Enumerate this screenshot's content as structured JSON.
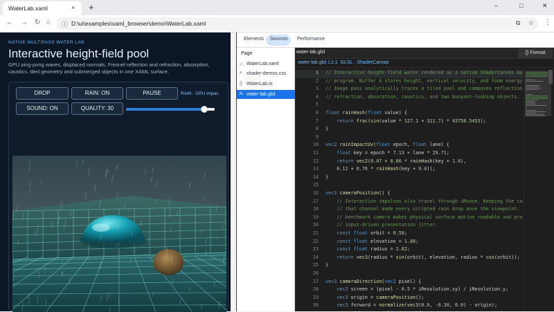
{
  "browser": {
    "tab_title": "WaterLab.xaml",
    "tab_close": "×",
    "new_tab": "+",
    "window_controls": {
      "minimize": "–",
      "maximize": "□",
      "close": "✕"
    },
    "nav": {
      "back": "←",
      "forward": "→",
      "reload": "↻",
      "home": "⌂"
    },
    "url": "D:\\ui\\examples\\xaml_browser\\demo\\WaterLab.xaml",
    "menu": "⋮"
  },
  "page": {
    "eyebrow": "NATIVE MULTIPASS WATER LAB",
    "title": "Interactive height-field pool",
    "description": "GPU ping-pong waves, displaced normals, Fresnel reflection and refraction, absorption, caustics, tiled geometry and submerged objects in one XAML surface.",
    "controls": {
      "drop": "DROP",
      "rain": "RAIN: ON",
      "pause": "PAUSE",
      "sound": "SOUND: ON",
      "quality": "QUALITY: 30",
      "status": "RAIN · GPU impac",
      "quality_slider_fraction": 0.88
    }
  },
  "devtools": {
    "tabs": [
      "Elements",
      "Sources",
      "Performance"
    ],
    "active_tab": "Sources",
    "files_header": "Page",
    "files": [
      {
        "icon": "◇",
        "name": "WaterLab.xaml"
      },
      {
        "icon": "#",
        "name": "shader-demos.css"
      },
      {
        "icon": "{}",
        "name": "WaterLab.ts"
      },
      {
        "icon": "fx",
        "name": "water-lab.glsl"
      }
    ],
    "editor": {
      "open_file": "water-lab.glsl",
      "format_label": "{}  Format",
      "status_file": "water-lab.glsl",
      "status_meta": "L1:1  GLSL · ShaderCanvas",
      "lines": [
        [
          [
            "c",
            "// Interactive height-field water rendered as a native ShaderCanvas mu"
          ]
        ],
        [
          [
            "c",
            "// program. Buffer A stores height, vertical velocity, and foam energy"
          ]
        ],
        [
          [
            "c",
            "// Image pass analytically traces a tiled pool and composes reflection"
          ]
        ],
        [
          [
            "c",
            "// refraction, absorption, caustics, and two buoyant-looking objects."
          ]
        ],
        [],
        [
          [
            "k",
            "float "
          ],
          [
            "f",
            "rainHash"
          ],
          [
            "i",
            "("
          ],
          [
            "k",
            "float "
          ],
          [
            "i",
            "value) {"
          ]
        ],
        [
          [
            "i",
            "    "
          ],
          [
            "k",
            "return "
          ],
          [
            "f",
            "frac"
          ],
          [
            "i",
            "("
          ],
          [
            "f",
            "sin"
          ],
          [
            "i",
            "(value * "
          ],
          [
            "n",
            "127.1"
          ],
          [
            "i",
            " + "
          ],
          [
            "n",
            "311.7"
          ],
          [
            "i",
            ") * "
          ],
          [
            "n",
            "43758.5453"
          ],
          [
            "i",
            ");"
          ]
        ],
        [
          [
            "i",
            "}"
          ]
        ],
        [],
        [
          [
            "k",
            "vec2 "
          ],
          [
            "f",
            "rainImpactUv"
          ],
          [
            "i",
            "("
          ],
          [
            "k",
            "float "
          ],
          [
            "i",
            "epoch, "
          ],
          [
            "k",
            "float "
          ],
          [
            "i",
            "lane) {"
          ]
        ],
        [
          [
            "i",
            "    "
          ],
          [
            "k",
            "float "
          ],
          [
            "i",
            "key = epoch * "
          ],
          [
            "n",
            "7.13"
          ],
          [
            "i",
            " + lane * "
          ],
          [
            "n",
            "29.71"
          ],
          [
            "i",
            ";"
          ]
        ],
        [
          [
            "i",
            "    "
          ],
          [
            "k",
            "return "
          ],
          [
            "f",
            "vec2"
          ],
          [
            "i",
            "("
          ],
          [
            "n",
            "0.07"
          ],
          [
            "i",
            " + "
          ],
          [
            "n",
            "0.86"
          ],
          [
            "i",
            " * "
          ],
          [
            "f",
            "rainHash"
          ],
          [
            "i",
            "(key + "
          ],
          [
            "n",
            "1.0"
          ],
          [
            "i",
            "),"
          ]
        ],
        [
          [
            "i",
            "    "
          ],
          [
            "n",
            "0.12"
          ],
          [
            "i",
            " + "
          ],
          [
            "n",
            "0.76"
          ],
          [
            "i",
            " * "
          ],
          [
            "f",
            "rainHash"
          ],
          [
            "i",
            "(key + "
          ],
          [
            "n",
            "9.0"
          ],
          [
            "i",
            "));"
          ]
        ],
        [
          [
            "i",
            "}"
          ]
        ],
        [],
        [
          [
            "k",
            "vec3 "
          ],
          [
            "f",
            "cameraPosition"
          ],
          [
            "i",
            "() {"
          ]
        ],
        [
          [
            "i",
            "    "
          ],
          [
            "c",
            "// Interaction impulses also travel through iMouse. Keeping the ca"
          ]
        ],
        [
          [
            "i",
            "    "
          ],
          [
            "c",
            "// that channel made every scripted rain drop move the viewpoint. ."
          ]
        ],
        [
          [
            "i",
            "    "
          ],
          [
            "c",
            "// benchmark camera makes physical surface motion readable and pre"
          ]
        ],
        [
          [
            "i",
            "    "
          ],
          [
            "c",
            "// input-driven presentation jitter."
          ]
        ],
        [
          [
            "i",
            "    "
          ],
          [
            "k",
            "const float "
          ],
          [
            "i",
            "orbit = "
          ],
          [
            "n",
            "0.58"
          ],
          [
            "i",
            ";"
          ]
        ],
        [
          [
            "i",
            "    "
          ],
          [
            "k",
            "const float "
          ],
          [
            "i",
            "elevation = "
          ],
          [
            "n",
            "1.88"
          ],
          [
            "i",
            ";"
          ]
        ],
        [
          [
            "i",
            "    "
          ],
          [
            "k",
            "const float "
          ],
          [
            "i",
            "radius = "
          ],
          [
            "n",
            "2.82"
          ],
          [
            "i",
            ";"
          ]
        ],
        [
          [
            "i",
            "    "
          ],
          [
            "k",
            "return "
          ],
          [
            "f",
            "vec3"
          ],
          [
            "i",
            "(radius * "
          ],
          [
            "f",
            "sin"
          ],
          [
            "i",
            "(orbit), elevation, radius * "
          ],
          [
            "f",
            "cos"
          ],
          [
            "i",
            "(orbit));"
          ]
        ],
        [
          [
            "i",
            "}"
          ]
        ],
        [],
        [
          [
            "k",
            "vec3 "
          ],
          [
            "f",
            "cameraDirection"
          ],
          [
            "i",
            "("
          ],
          [
            "k",
            "vec2 "
          ],
          [
            "i",
            "pixel) {"
          ]
        ],
        [
          [
            "i",
            "    "
          ],
          [
            "k",
            "vec2 "
          ],
          [
            "i",
            "screen = (pixel - "
          ],
          [
            "n",
            "0.5"
          ],
          [
            "i",
            " * iResolution.xy) / iResolution.y;"
          ]
        ],
        [
          [
            "i",
            "    "
          ],
          [
            "k",
            "vec3 "
          ],
          [
            "i",
            "origin = "
          ],
          [
            "f",
            "cameraPosition"
          ],
          [
            "i",
            "();"
          ]
        ],
        [
          [
            "i",
            "    "
          ],
          [
            "k",
            "vec3 "
          ],
          [
            "i",
            "forward = "
          ],
          [
            "f",
            "normalize"
          ],
          [
            "i",
            "("
          ],
          [
            "f",
            "vec3"
          ],
          [
            "i",
            "("
          ],
          [
            "n",
            "0.0"
          ],
          [
            "i",
            ", "
          ],
          [
            "n",
            "-0.30"
          ],
          [
            "i",
            ", "
          ],
          [
            "n",
            "0.0"
          ],
          [
            "i",
            ") - origin);"
          ]
        ],
        [
          [
            "i",
            "    "
          ],
          [
            "k",
            "vec3 "
          ],
          [
            "i",
            "right = "
          ],
          [
            "f",
            "normalize"
          ],
          [
            "i",
            "("
          ],
          [
            "f",
            "cross"
          ],
          [
            "i",
            "(forward, "
          ],
          [
            "f",
            "vec3"
          ],
          [
            "i",
            "("
          ],
          [
            "n",
            "0.0"
          ],
          [
            "i",
            ", "
          ],
          [
            "n",
            "1.0"
          ],
          [
            "i",
            ", "
          ],
          [
            "n",
            "0.0"
          ],
          [
            "i",
            ")));"
          ]
        ]
      ]
    }
  },
  "colors": {
    "page_bg": "#0d1624",
    "accent": "#5fb4ff",
    "selection": "#1a73e8",
    "water": "#1f6b75",
    "tile_grout": "#7fd9d2"
  }
}
